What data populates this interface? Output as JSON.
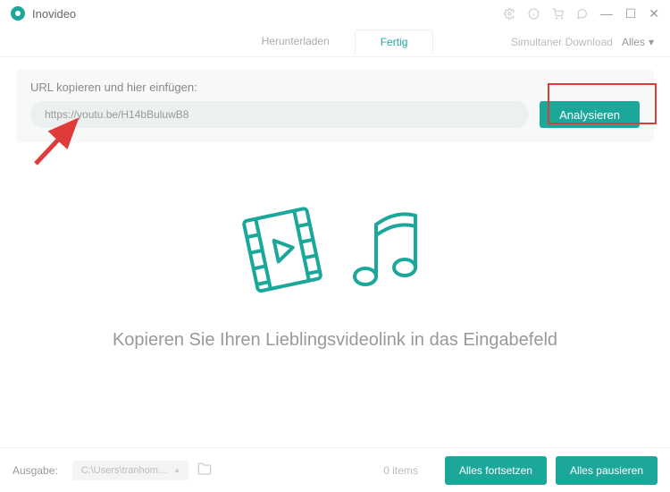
{
  "app": {
    "name": "Inovideo"
  },
  "tabs": {
    "download": "Herunterladen",
    "done": "Fertig"
  },
  "simul": {
    "label": "Simultaner Download",
    "value": "Alles"
  },
  "url_section": {
    "label": "URL kopieren und hier einfügen:",
    "value": "https://youtu.be/H14bBuluwB8",
    "analyze": "Analysieren"
  },
  "hero": {
    "text": "Kopieren Sie Ihren Lieblingsvideolink in das Eingabefeld"
  },
  "bottom": {
    "output_label": "Ausgabe:",
    "output_path": "C:\\Users\\tranhom\\Inovi",
    "items": "0 items",
    "resume_all": "Alles fortsetzen",
    "pause_all": "Alles pausieren"
  }
}
